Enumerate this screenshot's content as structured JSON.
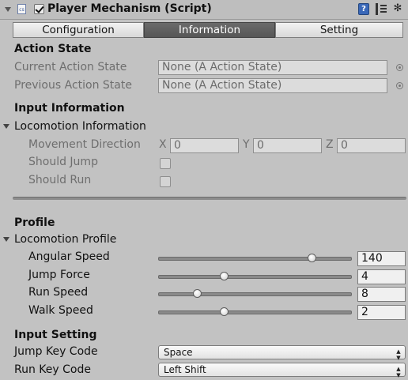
{
  "header": {
    "script_icon_text": "cs",
    "enabled": true,
    "title": "Player Mechanism (Script)",
    "help_icon_text": "?",
    "gear_icon_text": "✻"
  },
  "tabs": [
    {
      "label": "Configuration",
      "active": false
    },
    {
      "label": "Information",
      "active": true
    },
    {
      "label": "Setting",
      "active": false
    }
  ],
  "action_state": {
    "heading": "Action State",
    "current_label": "Current Action State",
    "current_value": "None (A Action State)",
    "previous_label": "Previous Action State",
    "previous_value": "None (A Action State)"
  },
  "input_information": {
    "heading": "Input Information",
    "foldout_label": "Locomotion Information",
    "movement_label": "Movement Direction",
    "axis_x": "X",
    "value_x": "0",
    "axis_y": "Y",
    "value_y": "0",
    "axis_z": "Z",
    "value_z": "0",
    "should_jump_label": "Should Jump",
    "should_run_label": "Should Run"
  },
  "profile": {
    "heading": "Profile",
    "foldout_label": "Locomotion Profile",
    "sliders": [
      {
        "label": "Angular Speed",
        "value": "140",
        "fraction": 0.8
      },
      {
        "label": "Jump Force",
        "value": "4",
        "fraction": 0.34
      },
      {
        "label": "Run Speed",
        "value": "8",
        "fraction": 0.2
      },
      {
        "label": "Walk Speed",
        "value": "2",
        "fraction": 0.34
      }
    ]
  },
  "input_setting": {
    "heading": "Input Setting",
    "jump_label": "Jump Key Code",
    "jump_value": "Space",
    "run_label": "Run Key Code",
    "run_value": "Left Shift",
    "dropdown_arrow": "▲▼"
  },
  "colors": {
    "background": "#c2c2c2",
    "active_tab": "#5e5e5e",
    "help_icon": "#3a68b8"
  }
}
